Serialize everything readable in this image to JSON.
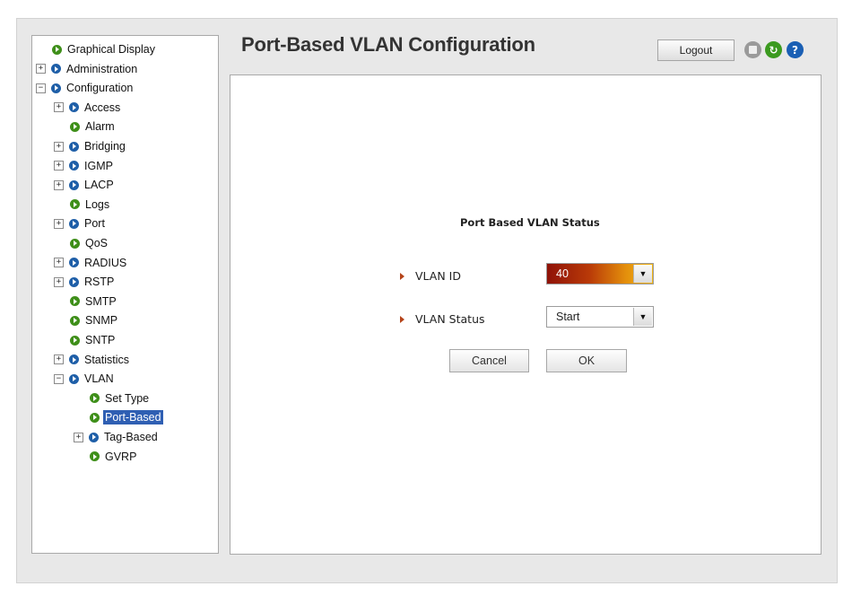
{
  "page": {
    "title": "Port-Based VLAN Configuration",
    "logout_label": "Logout"
  },
  "icons": {
    "save": "save-icon",
    "refresh": "refresh-icon",
    "help": "help-icon",
    "help_glyph": "?",
    "refresh_glyph": "↻"
  },
  "colors": {
    "selected": "#2f5fb3",
    "green_node": "#3f8f1a",
    "blue_node": "#1f5fa8"
  },
  "nav": [
    {
      "label": "Graphical Display",
      "level": 0,
      "expander": "",
      "icon": "green"
    },
    {
      "label": "Administration",
      "level": 0,
      "expander": "+",
      "icon": "blue"
    },
    {
      "label": "Configuration",
      "level": 0,
      "expander": "−",
      "icon": "blue"
    },
    {
      "label": "Access",
      "level": 1,
      "expander": "+",
      "icon": "blue"
    },
    {
      "label": "Alarm",
      "level": 1,
      "expander": "",
      "icon": "green"
    },
    {
      "label": "Bridging",
      "level": 1,
      "expander": "+",
      "icon": "blue"
    },
    {
      "label": "IGMP",
      "level": 1,
      "expander": "+",
      "icon": "blue"
    },
    {
      "label": "LACP",
      "level": 1,
      "expander": "+",
      "icon": "blue"
    },
    {
      "label": "Logs",
      "level": 1,
      "expander": "",
      "icon": "green"
    },
    {
      "label": "Port",
      "level": 1,
      "expander": "+",
      "icon": "blue"
    },
    {
      "label": "QoS",
      "level": 1,
      "expander": "",
      "icon": "green"
    },
    {
      "label": "RADIUS",
      "level": 1,
      "expander": "+",
      "icon": "blue"
    },
    {
      "label": "RSTP",
      "level": 1,
      "expander": "+",
      "icon": "blue"
    },
    {
      "label": "SMTP",
      "level": 1,
      "expander": "",
      "icon": "green"
    },
    {
      "label": "SNMP",
      "level": 1,
      "expander": "",
      "icon": "green"
    },
    {
      "label": "SNTP",
      "level": 1,
      "expander": "",
      "icon": "green"
    },
    {
      "label": "Statistics",
      "level": 1,
      "expander": "+",
      "icon": "blue"
    },
    {
      "label": "VLAN",
      "level": 1,
      "expander": "−",
      "icon": "blue"
    },
    {
      "label": "Set Type",
      "level": 2,
      "expander": "",
      "icon": "green"
    },
    {
      "label": "Port-Based",
      "level": 2,
      "expander": "",
      "icon": "green",
      "selected": true
    },
    {
      "label": "Tag-Based",
      "level": 2,
      "expander": "+",
      "icon": "blue"
    },
    {
      "label": "GVRP",
      "level": 2,
      "expander": "",
      "icon": "green"
    }
  ],
  "form": {
    "heading": "Port Based VLAN Status",
    "vlan_id_label": "VLAN ID",
    "vlan_id_value": "40",
    "vlan_status_label": "VLAN Status",
    "vlan_status_value": "Start",
    "cancel_label": "Cancel",
    "ok_label": "OK"
  }
}
